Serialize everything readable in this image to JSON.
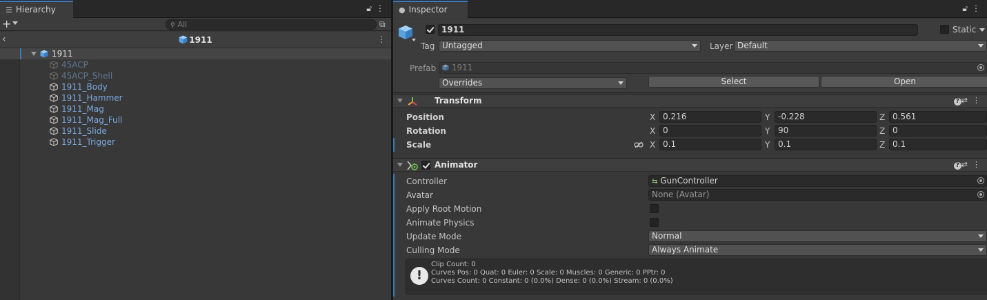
{
  "hierarchy": {
    "tab_label": "Hierarchy",
    "tab_icon": "list-icon",
    "add_label": "+",
    "search_placeholder": "All",
    "prefab_title": "1911",
    "tree": {
      "root": "1911",
      "children": [
        {
          "label": "45ACP",
          "dim": true
        },
        {
          "label": "45ACP_Shell",
          "dim": true
        },
        {
          "label": "1911_Body",
          "dim": false
        },
        {
          "label": "1911_Hammer",
          "dim": false
        },
        {
          "label": "1911_Mag",
          "dim": false
        },
        {
          "label": "1911_Mag_Full",
          "dim": false
        },
        {
          "label": "1911_Slide",
          "dim": false
        },
        {
          "label": "1911_Trigger",
          "dim": false
        }
      ]
    }
  },
  "inspector": {
    "tab_label": "Inspector",
    "tab_icon": "info-icon",
    "object": {
      "name": "1911",
      "active": true,
      "static_label": "Static",
      "static": false,
      "tag_label": "Tag",
      "tag_value": "Untagged",
      "layer_label": "Layer",
      "layer_value": "Default",
      "prefab_label": "Prefab",
      "prefab_value": "1911",
      "overrides_label": "Overrides",
      "select_label": "Select",
      "open_label": "Open"
    },
    "transform": {
      "title": "Transform",
      "position": {
        "label": "Position",
        "x": "0.216",
        "y": "-0.228",
        "z": "0.561"
      },
      "rotation": {
        "label": "Rotation",
        "x": "0",
        "y": "90",
        "z": "0"
      },
      "scale": {
        "label": "Scale",
        "x": "0.1",
        "y": "0.1",
        "z": "0.1"
      },
      "axis_x": "X",
      "axis_y": "Y",
      "axis_z": "Z"
    },
    "animator": {
      "title": "Animator",
      "enabled": true,
      "controller_label": "Controller",
      "controller_value": "GunController",
      "avatar_label": "Avatar",
      "avatar_value": "None (Avatar)",
      "apply_root_motion_label": "Apply Root Motion",
      "apply_root_motion": false,
      "animate_physics_label": "Animate Physics",
      "animate_physics": false,
      "update_mode_label": "Update Mode",
      "update_mode_value": "Normal",
      "culling_mode_label": "Culling Mode",
      "culling_mode_value": "Always Animate",
      "info": {
        "line1": "Clip Count: 0",
        "line2": "Curves Pos: 0 Quat: 0 Euler: 0 Scale: 0 Muscles: 0 Generic: 0 PPtr: 0",
        "line3": "Curves Count: 0 Constant: 0 (0.0%) Dense: 0 (0.0%) Stream: 0 (0.0%)"
      }
    }
  },
  "colors": {
    "accent": "#3a79bb",
    "child_label": "#7ca8e0",
    "dim_label": "#5f7794",
    "cube_blue": "#5aa0de"
  }
}
